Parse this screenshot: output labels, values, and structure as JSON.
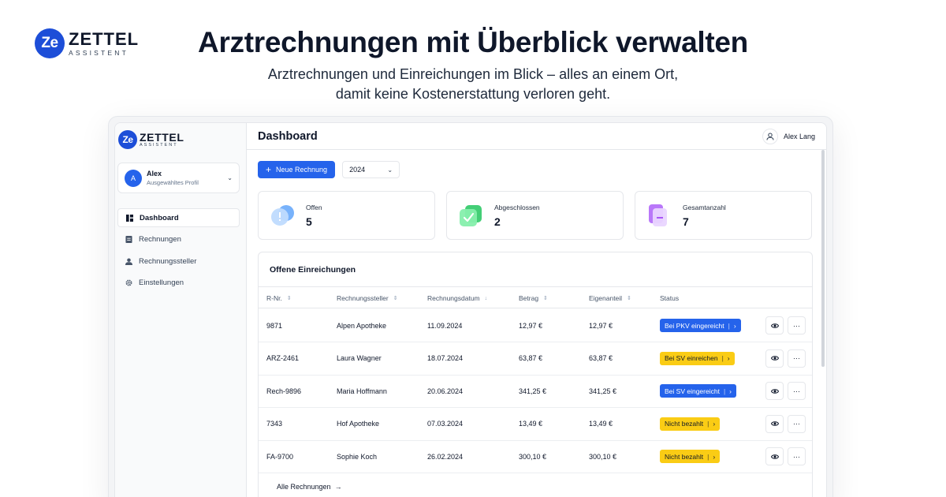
{
  "hero": {
    "brand_badge": "Ze",
    "brand_name": "ZETTEL",
    "brand_sub": "ASSISTENT",
    "title": "Arztrechnungen mit Überblick verwalten",
    "subtitle_line1": "Arztrechnungen und Einreichungen im Blick – alles an einem Ort,",
    "subtitle_line2": "damit keine Kostenerstattung verloren geht."
  },
  "sidebar": {
    "brand_badge": "Ze",
    "brand_name": "ZETTEL",
    "brand_sub": "ASSISTENT",
    "profile": {
      "initial": "A",
      "name": "Alex",
      "sub": "Ausgewähltes Profil"
    },
    "items": [
      {
        "label": "Dashboard",
        "icon": "dashboard-icon",
        "active": true
      },
      {
        "label": "Rechnungen",
        "icon": "document-icon",
        "active": false
      },
      {
        "label": "Rechnungssteller",
        "icon": "user-group-icon",
        "active": false
      },
      {
        "label": "Einstellungen",
        "icon": "gear-icon",
        "active": false
      }
    ]
  },
  "topbar": {
    "title": "Dashboard",
    "user_name": "Alex Lang"
  },
  "toolbar": {
    "new_invoice_label": "Neue Rechnung",
    "year": "2024"
  },
  "stats": [
    {
      "label": "Offen",
      "value": "5",
      "icon": "alert-circle-icon"
    },
    {
      "label": "Abgeschlossen",
      "value": "2",
      "icon": "check-icon"
    },
    {
      "label": "Gesamtanzahl",
      "value": "7",
      "icon": "documents-icon"
    }
  ],
  "table": {
    "title": "Offene Einreichungen",
    "columns": [
      "R-Nr.",
      "Rechnungssteller",
      "Rechnungsdatum",
      "Betrag",
      "Eigenanteil",
      "Status"
    ],
    "rows": [
      {
        "nr": "9871",
        "issuer": "Alpen Apotheke",
        "date": "11.09.2024",
        "amount": "12,97 €",
        "own": "12,97 €",
        "status": "Bei PKV eingereicht",
        "status_color": "blue"
      },
      {
        "nr": "ARZ-2461",
        "issuer": "Laura Wagner",
        "date": "18.07.2024",
        "amount": "63,87 €",
        "own": "63,87 €",
        "status": "Bei SV einreichen",
        "status_color": "yellow"
      },
      {
        "nr": "Rech-9896",
        "issuer": "Maria Hoffmann",
        "date": "20.06.2024",
        "amount": "341,25 €",
        "own": "341,25 €",
        "status": "Bei SV eingereicht",
        "status_color": "blue"
      },
      {
        "nr": "7343",
        "issuer": "Hof Apotheke",
        "date": "07.03.2024",
        "amount": "13,49 €",
        "own": "13,49 €",
        "status": "Nicht bezahlt",
        "status_color": "yellow"
      },
      {
        "nr": "FA-9700",
        "issuer": "Sophie Koch",
        "date": "26.02.2024",
        "amount": "300,10 €",
        "own": "300,10 €",
        "status": "Nicht bezahlt",
        "status_color": "yellow"
      }
    ],
    "all_link": "Alle Rechnungen"
  },
  "colors": {
    "primary": "#2563eb",
    "warning": "#facc15",
    "text": "#0f172a"
  }
}
